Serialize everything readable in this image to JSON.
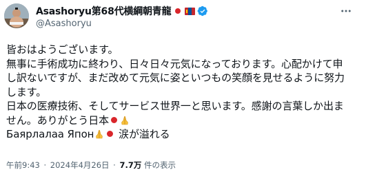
{
  "author": {
    "display_name": "Asashoryu第68代横綱朝青龍",
    "handle": "@Asashoryu",
    "verified": true,
    "name_emojis": [
      "japan-flag",
      "mongolia-flag"
    ]
  },
  "post": {
    "lines": [
      "皆おはようございます。",
      "無事に手術成功に終わり、日々日々元気になっております。心配かけて申",
      "し訳ないですが、まだ改めて元気に姿といつもの笑顔を見せるように努力",
      "します。",
      "日本の医療技術、そしてサービス世界一と思います。感謝の言葉しか出ま",
      "せん。ありがとう日本",
      "Баярлалаа Япон",
      "涙が溢れる"
    ]
  },
  "meta": {
    "time": "午前9:43",
    "separator": "·",
    "date": "2024年4月26日",
    "views_count": "7.7万",
    "views_label": "件の表示"
  },
  "colors": {
    "text": "#0f1419",
    "secondary": "#536471",
    "verified_blue": "#1d9bf0",
    "japan_red": "#d9262b"
  },
  "icons": {
    "more": "more-options-icon",
    "verified": "verified-badge-icon",
    "pray": "folded-hands-emoji",
    "japan": "japan-flag-emoji"
  }
}
